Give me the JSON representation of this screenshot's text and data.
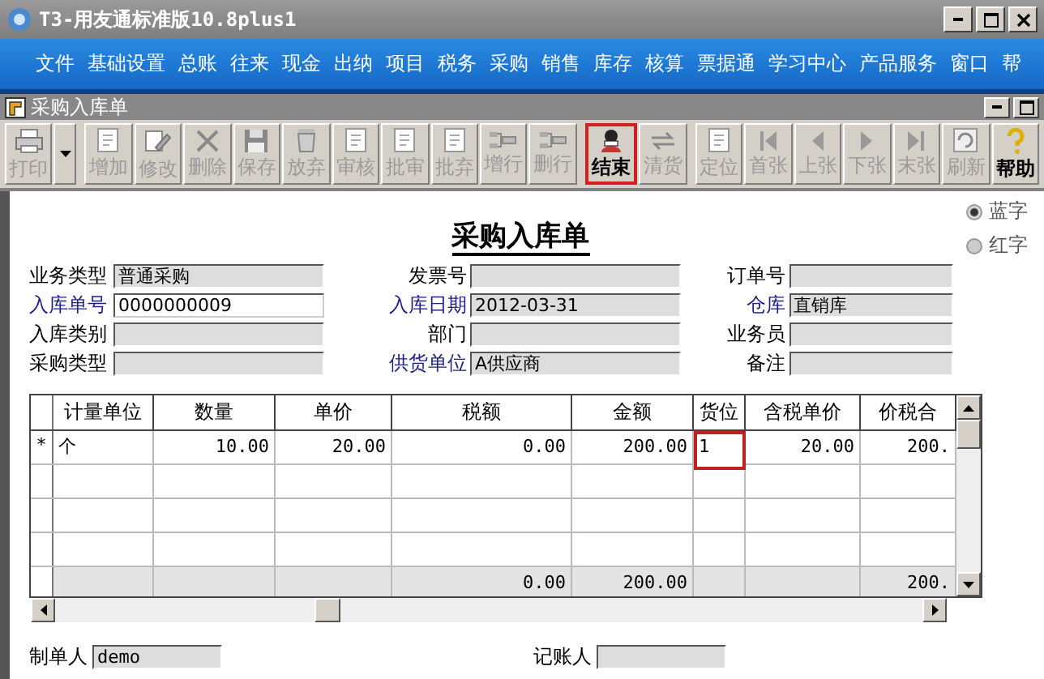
{
  "window": {
    "title": "T3-用友通标准版10.8plus1"
  },
  "menu": [
    "文件",
    "基础设置",
    "总账",
    "往来",
    "现金",
    "出纳",
    "项目",
    "税务",
    "采购",
    "销售",
    "库存",
    "核算",
    "票据通",
    "学习中心",
    "产品服务",
    "窗口",
    "帮"
  ],
  "document_window": {
    "title": "采购入库单"
  },
  "toolbar": [
    {
      "label": "打印",
      "kind": "printer",
      "enabled": false,
      "highlighted": false,
      "dropdown": true
    },
    {
      "label": "增加",
      "kind": "document",
      "enabled": false,
      "highlighted": false,
      "dropdown": false
    },
    {
      "label": "修改",
      "kind": "pencil",
      "enabled": false,
      "highlighted": false,
      "dropdown": false
    },
    {
      "label": "删除",
      "kind": "cross",
      "enabled": false,
      "highlighted": false,
      "dropdown": false
    },
    {
      "label": "保存",
      "kind": "disk",
      "enabled": false,
      "highlighted": false,
      "dropdown": false
    },
    {
      "label": "放弃",
      "kind": "trash",
      "enabled": false,
      "highlighted": false,
      "dropdown": false
    },
    {
      "label": "审核",
      "kind": "document",
      "enabled": false,
      "highlighted": false,
      "dropdown": false
    },
    {
      "label": "批审",
      "kind": "document",
      "enabled": false,
      "highlighted": false,
      "dropdown": false
    },
    {
      "label": "批弃",
      "kind": "document",
      "enabled": false,
      "highlighted": false,
      "dropdown": false
    },
    {
      "label": "增行",
      "kind": "rows",
      "enabled": false,
      "highlighted": false,
      "dropdown": false
    },
    {
      "label": "删行",
      "kind": "rows",
      "enabled": false,
      "highlighted": false,
      "dropdown": false
    },
    {
      "label": "结束",
      "kind": "person",
      "enabled": true,
      "highlighted": true,
      "dropdown": false
    },
    {
      "label": "清货",
      "kind": "arrows",
      "enabled": false,
      "highlighted": false,
      "dropdown": false
    },
    {
      "label": "定位",
      "kind": "document",
      "enabled": false,
      "highlighted": false,
      "dropdown": false
    },
    {
      "label": "首张",
      "kind": "first",
      "enabled": false,
      "highlighted": false,
      "dropdown": false
    },
    {
      "label": "上张",
      "kind": "prev",
      "enabled": false,
      "highlighted": false,
      "dropdown": false
    },
    {
      "label": "下张",
      "kind": "next",
      "enabled": false,
      "highlighted": false,
      "dropdown": false
    },
    {
      "label": "末张",
      "kind": "last",
      "enabled": false,
      "highlighted": false,
      "dropdown": false
    },
    {
      "label": "刷新",
      "kind": "refresh",
      "enabled": false,
      "highlighted": false,
      "dropdown": false
    },
    {
      "label": "帮助",
      "kind": "question",
      "enabled": true,
      "highlighted": false,
      "dropdown": false
    }
  ],
  "form": {
    "title": "采购入库单",
    "color_options": [
      {
        "label": "蓝字",
        "selected": true
      },
      {
        "label": "红字",
        "selected": false
      }
    ],
    "fields": [
      {
        "label": "业务类型",
        "value": "普通采购",
        "required": false,
        "editable": false
      },
      {
        "label": "发票号",
        "required": false,
        "editable": false
      },
      {
        "label": "订单号",
        "required": false,
        "editable": false
      },
      {
        "label": "入库单号",
        "value": "0000000009",
        "required": true,
        "editable": true
      },
      {
        "label": "入库日期",
        "value": "2012-03-31",
        "required": true,
        "editable": false
      },
      {
        "label": "仓库",
        "value": "直销库",
        "required": true,
        "editable": false
      },
      {
        "label": "入库类别",
        "required": false,
        "editable": false
      },
      {
        "label": "部门",
        "required": false,
        "editable": false
      },
      {
        "label": "业务员",
        "required": false,
        "editable": false
      },
      {
        "label": "采购类型",
        "required": false,
        "editable": false
      },
      {
        "label": "供货单位",
        "value": "A供应商",
        "required": true,
        "editable": false
      },
      {
        "label": "备注",
        "required": false,
        "editable": false
      }
    ]
  },
  "table": {
    "columns": [
      {
        "label": "计量单位"
      },
      {
        "label": "数量"
      },
      {
        "label": "单价"
      },
      {
        "label": "税额",
        "total": "0.00"
      },
      {
        "label": "金额",
        "total": "200.00"
      },
      {
        "label": "货位"
      },
      {
        "label": "含税单价"
      },
      {
        "label": "价税合",
        "total": "200."
      }
    ],
    "rows": [
      {
        "marker": "*",
        "cells": [
          {
            "text": "个",
            "highlighted": false
          },
          {
            "text": "10.00",
            "highlighted": false
          },
          {
            "text": "20.00",
            "highlighted": false
          },
          {
            "text": "0.00",
            "highlighted": false
          },
          {
            "text": "200.00",
            "highlighted": false
          },
          {
            "text": "1",
            "highlighted": true
          },
          {
            "text": "20.00",
            "highlighted": false
          },
          {
            "text": "200.",
            "highlighted": false
          }
        ]
      }
    ]
  },
  "footer": [
    {
      "label": "制单人",
      "value": "demo"
    },
    {
      "label": "记账人"
    }
  ]
}
